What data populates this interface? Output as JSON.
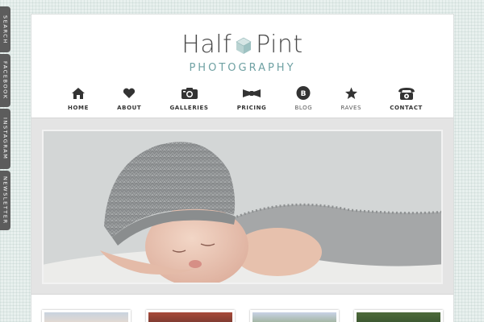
{
  "side_tabs": [
    {
      "label": "Search"
    },
    {
      "label": "Facebook"
    },
    {
      "label": "Instagram"
    },
    {
      "label": "Newsletter"
    }
  ],
  "brand": {
    "name_left": "Half",
    "name_right": "Pint",
    "tagline": "PHOTOGRAPHY"
  },
  "nav": [
    {
      "label": "HOME",
      "icon": "house-icon"
    },
    {
      "label": "ABOUT",
      "icon": "heart-icon"
    },
    {
      "label": "GALLERIES",
      "icon": "camera-icon"
    },
    {
      "label": "PRICING",
      "icon": "bowtie-icon"
    },
    {
      "label": "BLOG",
      "icon": "blog-bubble-icon"
    },
    {
      "label": "RAVES",
      "icon": "star-icon"
    },
    {
      "label": "CONTACT",
      "icon": "telephone-icon"
    }
  ],
  "colors": {
    "accent": "#6fa1a3",
    "dark_text": "#4a4a4a",
    "tab_bg": "#5c5c5c",
    "background": "#e8f0ee"
  }
}
